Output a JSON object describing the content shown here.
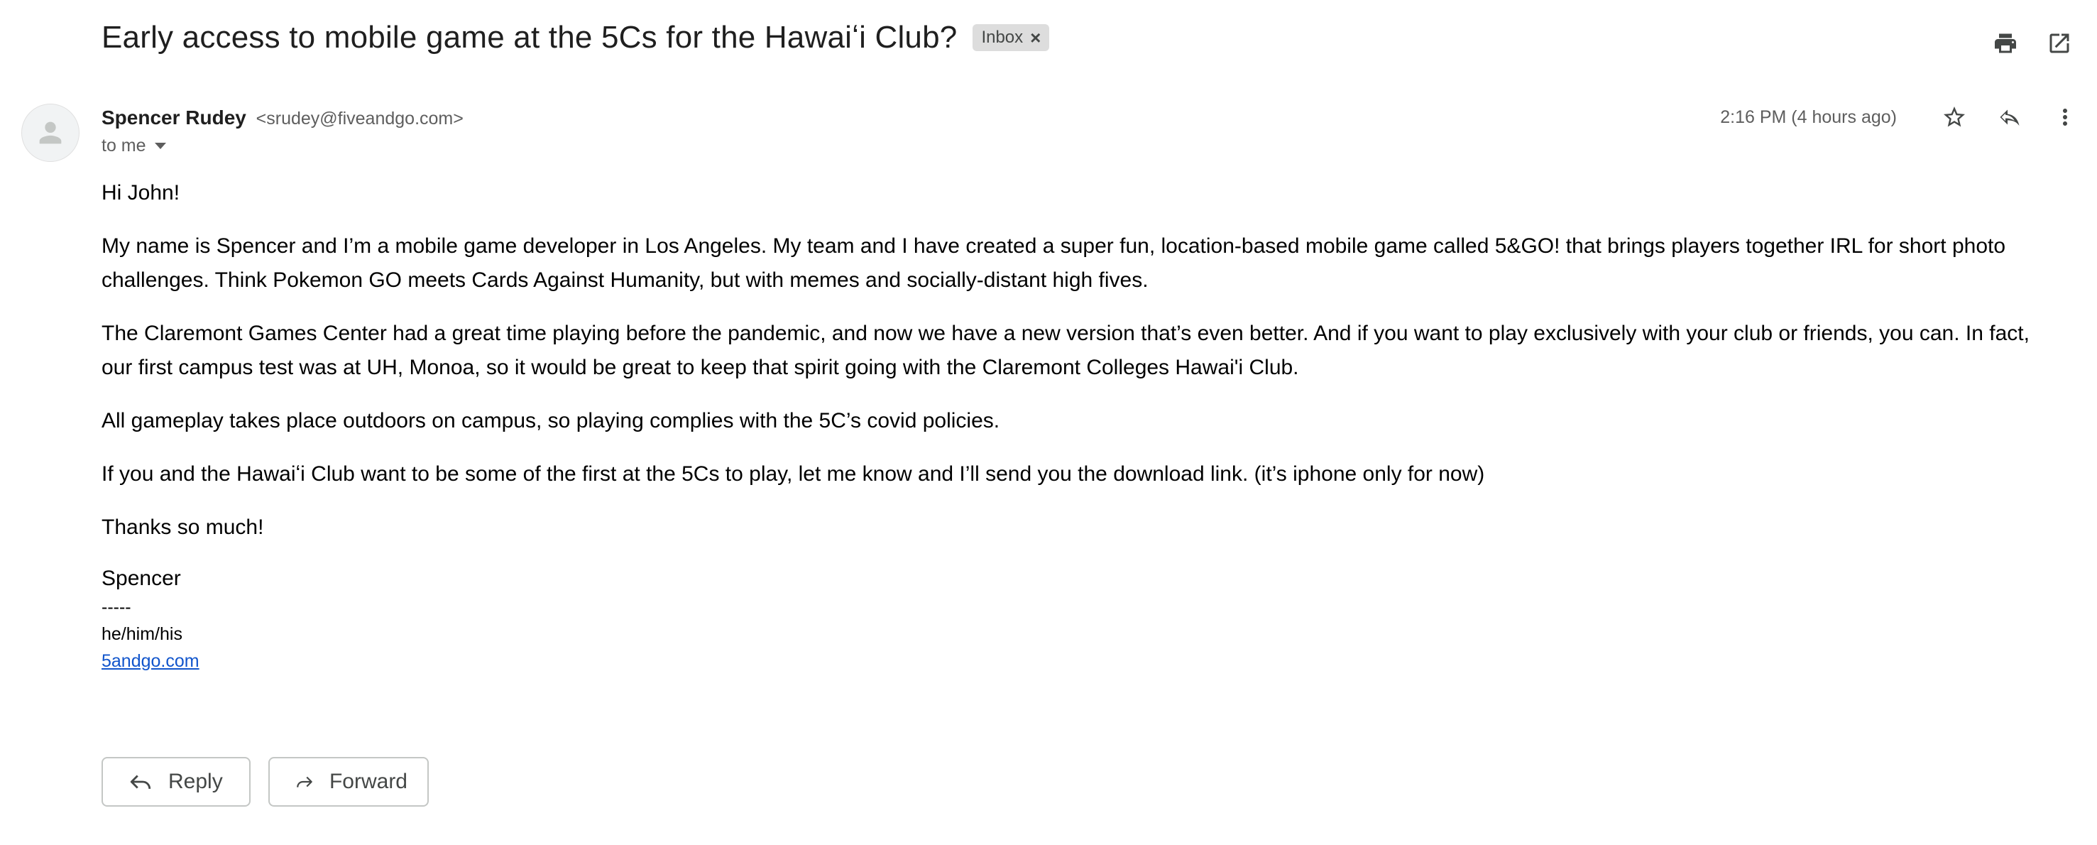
{
  "email": {
    "subject": "Early access to mobile game at the 5Cs for the Hawaiʻi Club?",
    "label": "Inbox",
    "label_remove": "×",
    "sender_name": "Spencer Rudey",
    "sender_email": "<srudey@fiveandgo.com>",
    "recipient": "to me",
    "timestamp": "2:16 PM (4 hours ago)"
  },
  "body": {
    "greeting": "Hi John!",
    "paragraphs": [
      "My name is Spencer and I’m a mobile game developer in Los Angeles. My team and I have created a super fun, location-based mobile game called 5&GO! that brings players together IRL for short photo challenges. Think Pokemon GO meets Cards Against Humanity, but with memes and socially-distant high fives.",
      "The Claremont Games Center had a great time playing before the pandemic, and now we have a new version that’s even better. And if you want to play exclusively with your club or friends, you can. In fact, our first campus test was at UH, Monoa, so it would be great to keep that spirit going with the Claremont Colleges Hawai'i Club.",
      "All gameplay takes place outdoors on campus, so playing complies with the 5C’s covid policies.",
      "If you and the Hawaiʻi Club want to be some of the first at the 5Cs to play, let me know and I’ll send you the download link. (it’s iphone only for now)"
    ],
    "closing": "Thanks so much!"
  },
  "signature": {
    "name": "Spencer",
    "divider": "-----",
    "pronouns": "he/him/his",
    "link": "5andgo.com"
  },
  "actions": {
    "reply_label": "Reply",
    "forward_label": "Forward"
  },
  "icons": {
    "print": "print-icon",
    "open_new_window": "open-in-new-window-icon",
    "star": "star-icon",
    "reply": "reply-icon",
    "more": "more-vert-icon",
    "avatar": "person-icon",
    "forward": "forward-icon"
  },
  "colors": {
    "link": "#1155cc",
    "chip_bg": "#dddddd",
    "icon": "#444746"
  }
}
